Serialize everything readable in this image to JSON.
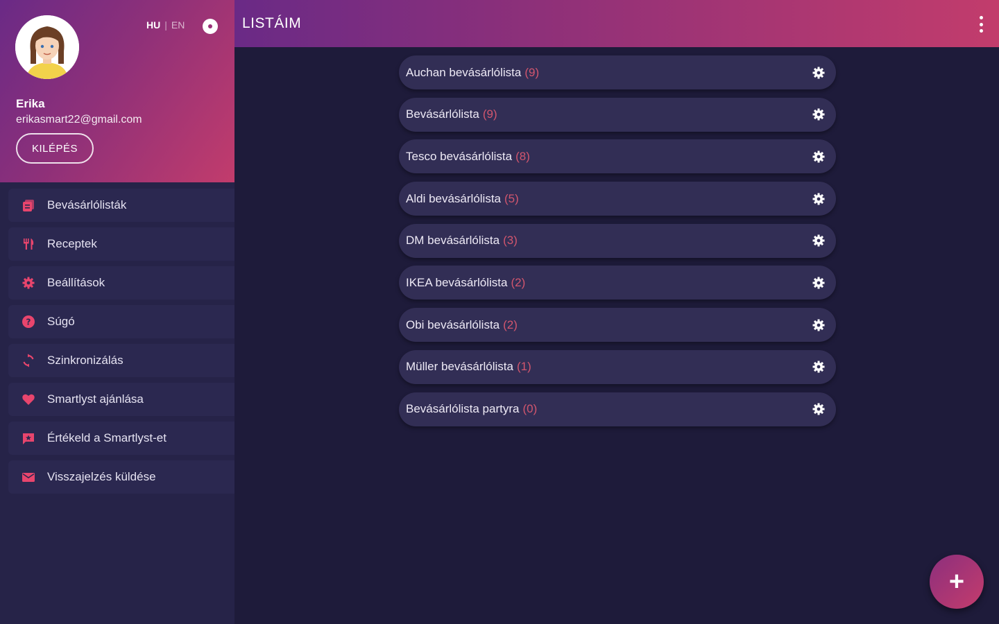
{
  "profile": {
    "name": "Erika",
    "email": "erikasmart22@gmail.com",
    "logout_label": "KILÉPÉS",
    "lang_hu": "HU",
    "lang_sep": "|",
    "lang_en": "EN"
  },
  "header": {
    "title": "LISTÁIM"
  },
  "nav": [
    {
      "label": "Bevásárlólisták",
      "icon": "lists-icon"
    },
    {
      "label": "Receptek",
      "icon": "cutlery-icon"
    },
    {
      "label": "Beállítások",
      "icon": "gear-icon"
    },
    {
      "label": "Súgó",
      "icon": "help-icon"
    },
    {
      "label": "Szinkronizálás",
      "icon": "sync-icon"
    },
    {
      "label": "Smartlyst ajánlása",
      "icon": "heart-icon"
    },
    {
      "label": "Értékeld a Smartlyst-et",
      "icon": "rate-icon"
    },
    {
      "label": "Visszajelzés küldése",
      "icon": "mail-icon"
    }
  ],
  "lists": [
    {
      "name": "Auchan bevásárlólista",
      "count": "(9)"
    },
    {
      "name": "Bevásárlólista",
      "count": "(9)"
    },
    {
      "name": "Tesco bevásárlólista",
      "count": "(8)"
    },
    {
      "name": "Aldi bevásárlólista",
      "count": "(5)"
    },
    {
      "name": "DM bevásárlólista",
      "count": "(3)"
    },
    {
      "name": "IKEA bevásárlólista",
      "count": "(2)"
    },
    {
      "name": "Obi bevásárlólista",
      "count": "(2)"
    },
    {
      "name": "Müller bevásárlólista",
      "count": "(1)"
    },
    {
      "name": "Bevásárlólista partyra",
      "count": "(0)"
    }
  ],
  "fab": {
    "label": "+"
  },
  "colors": {
    "accent": "#e8456d",
    "background": "#1e1b3a",
    "sidebar": "#262348",
    "row": "#322e55",
    "gradient_start": "#6a2a86",
    "gradient_end": "#c23c6c"
  }
}
